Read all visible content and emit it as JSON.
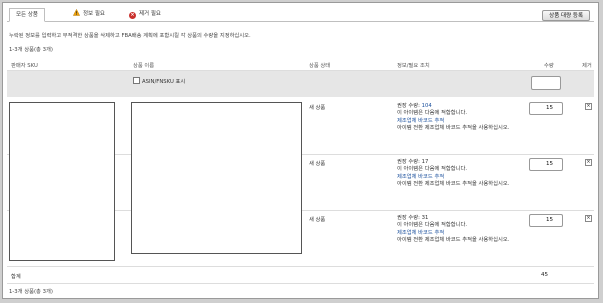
{
  "tabs": [
    {
      "label": "모든 상품"
    },
    {
      "label": "정보 필요"
    },
    {
      "label": "제거 필요"
    }
  ],
  "add_button_label": "상품 대량 등록",
  "instructions": "누락된 정보를 입력하고 부적격한 상품을 삭제하고 FBA배송 계획에 포함시킬 각 상품의 수량을 지정하십시오.",
  "count_label": "1-3개 상품(총 3개)",
  "columns": {
    "sku": "판매자 SKU",
    "name": "상품 이름",
    "condition": "상품 상태",
    "info": "정보/필요 조치",
    "quantity": "수량",
    "remove": "제거"
  },
  "filter": {
    "asin_label": "ASIN/FNSKU 표시",
    "qty_value": ""
  },
  "rows": [
    {
      "condition": "새 상품",
      "recommended_label": "권장 수량:",
      "recommended": "104",
      "eligible_text": "이 아이템은 다음에 적합합니다.",
      "link_text": "제조업체 바코드 추적",
      "note": "아이템 전환 제조업체 바코드 추적을 사용하십시오.",
      "quantity": "15",
      "remove_glyph": "×"
    },
    {
      "condition": "새 상품",
      "recommended_label": "권장 수량:",
      "recommended": "17",
      "eligible_text": "이 아이템은 다음에 적합합니다.",
      "link_text": "제조업체 바코드 추적",
      "note": "아이템 전환 제조업체 바코드 추적을 사용하십시오.",
      "quantity": "15",
      "remove_glyph": "×"
    },
    {
      "condition": "새 상품",
      "recommended_label": "권장 수량:",
      "recommended": "31",
      "eligible_text": "이 아이템은 다음에 적합합니다.",
      "link_text": "제조업체 바코드 추적",
      "note": "아이템 전환 제조업체 바코드 추적을 사용하십시오.",
      "quantity": "15",
      "remove_glyph": "×"
    }
  ],
  "total": {
    "label": "합계",
    "value": "45"
  },
  "icons": {
    "warning": "warning-icon",
    "error": "error-icon"
  },
  "colors": {
    "link": "#1a4f9c",
    "error": "#c9302c",
    "warning": "#f0a30a"
  }
}
